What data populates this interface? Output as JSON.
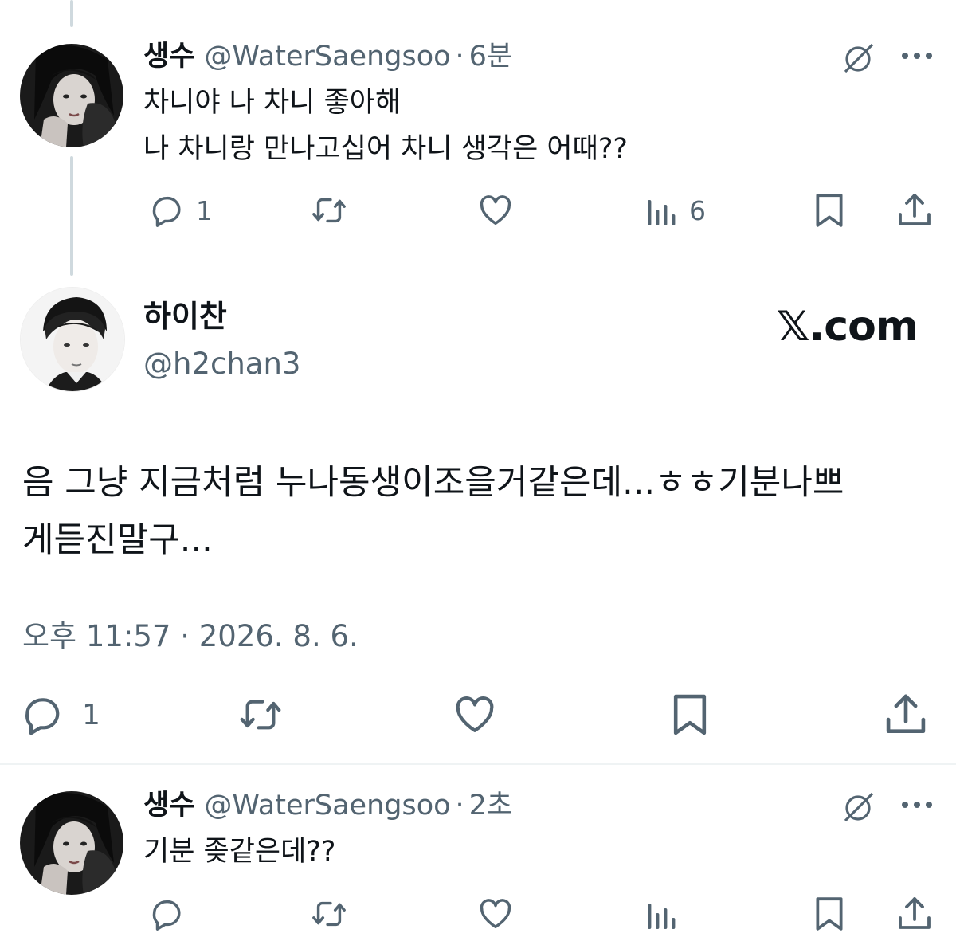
{
  "reply1": {
    "display_name": "생수",
    "handle": "@WaterSaengsoo",
    "time_ago": "6분",
    "separator": "·",
    "text": "차니야 나 차니 좋아해\n나 차니랑 만나고십어 차니 생각은 어때??",
    "replies_count": "1",
    "views_count": "6",
    "icons": [
      "grok-icon",
      "more-icon",
      "reply-icon",
      "retweet-icon",
      "like-icon",
      "views-icon",
      "bookmark-icon",
      "share-icon"
    ]
  },
  "main_tweet": {
    "display_name": "하이찬",
    "handle": "@h2chan3",
    "watermark": "𝕏.com",
    "text": "음 그냥 지금처럼 누나동생이조을거같은데...ㅎㅎ기분나쁘\n게듣진말구...",
    "timestamp": "오후 11:57 · 2026. 8. 6.",
    "replies_count": "1"
  },
  "reply2": {
    "display_name": "생수",
    "handle": "@WaterSaengsoo",
    "time_ago": "2초",
    "separator": "·",
    "text": "기분 좆같은데??"
  },
  "colors": {
    "text": "#0f1419",
    "secondary": "#536471",
    "thread_line": "#cfd9de",
    "divider": "#eff3f4"
  }
}
